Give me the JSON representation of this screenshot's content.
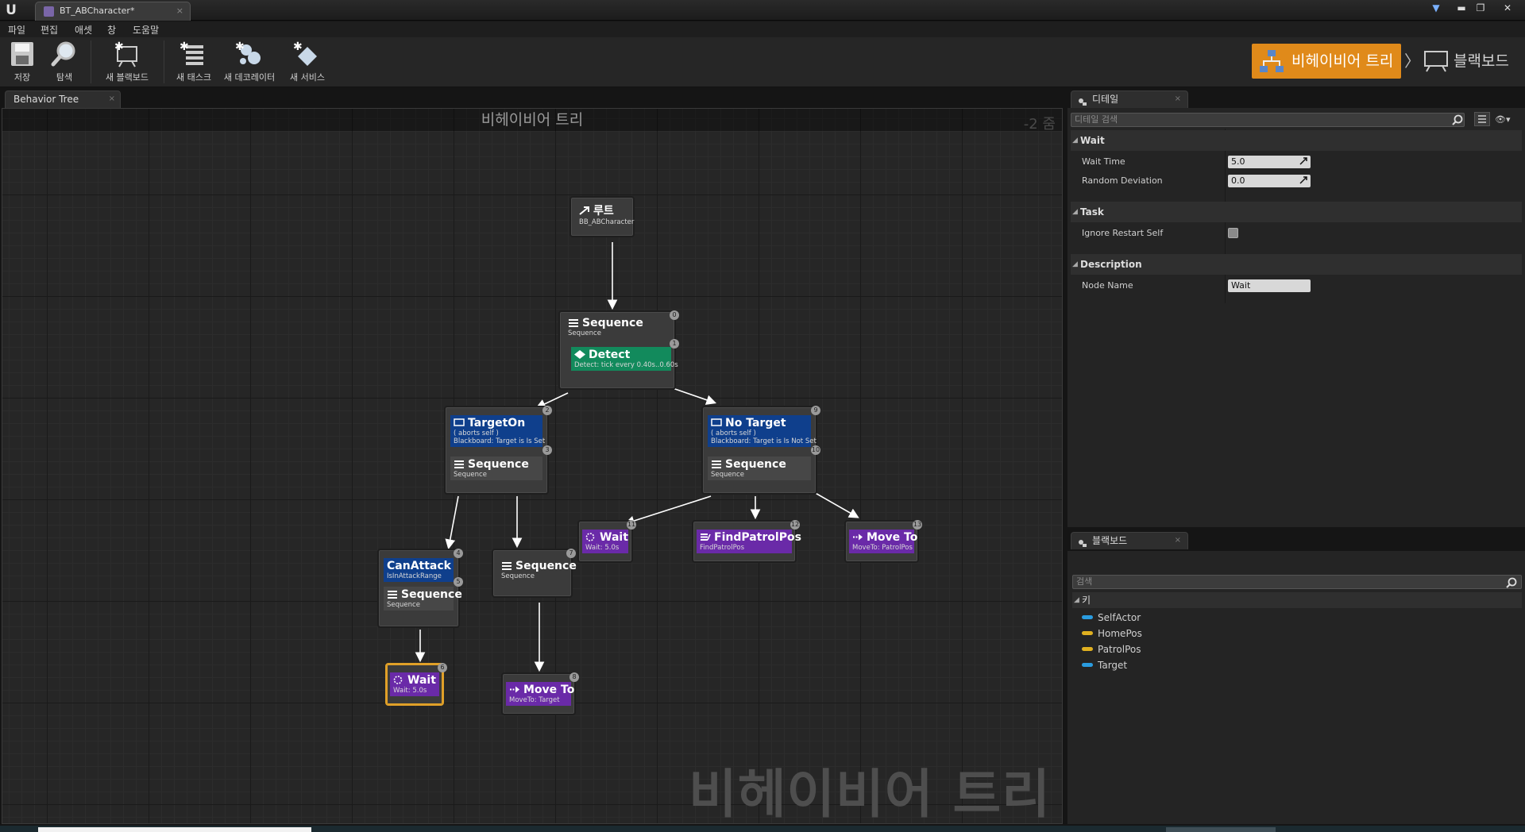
{
  "window": {
    "tab_title": "BT_ABCharacter*",
    "tab_close": "×",
    "controls": {
      "minimize": "▬",
      "restore": "❐",
      "close": "✕"
    }
  },
  "menu": [
    "파일",
    "편집",
    "애셋",
    "창",
    "도움말"
  ],
  "toolbar": {
    "save": "저장",
    "browse": "탐색",
    "new_blackboard": "새 블랙보드",
    "new_task": "새 태스크",
    "new_decorator": "새 데코레이터",
    "new_service": "새 서비스"
  },
  "modes": {
    "behavior_tree": "비헤이비어 트리",
    "chevron": "〉",
    "blackboard": "블랙보드"
  },
  "graph_tab": {
    "label": "Behavior Tree",
    "close": "×"
  },
  "graph": {
    "header": "비헤이비어 트리",
    "zoom": "-2 줌",
    "watermark": "비헤이비어 트리"
  },
  "nodes": {
    "root": {
      "title": "루트",
      "sub": "BB_ABCharacter"
    },
    "seq0": {
      "index": "0",
      "title": "Sequence",
      "sub": "Sequence"
    },
    "detect": {
      "index": "1",
      "title": "Detect",
      "sub": "Detect: tick every 0.40s..0.60s"
    },
    "targeton": {
      "index": "2",
      "title": "TargetOn",
      "sub1": "( aborts self )",
      "sub2": "Blackboard: Target is Is Set",
      "index2": "3",
      "seq_title": "Sequence",
      "seq_sub": "Sequence"
    },
    "notarget": {
      "index": "9",
      "title": "No Target",
      "sub1": "( aborts self )",
      "sub2": "Blackboard: Target is Is Not Set",
      "index2": "10",
      "seq_title": "Sequence",
      "seq_sub": "Sequence"
    },
    "canattack": {
      "index": "4",
      "title": "CanAttack",
      "sub": "IsInAttackRange",
      "index2": "5",
      "seq_title": "Sequence",
      "seq_sub": "Sequence"
    },
    "seq7": {
      "index": "7",
      "title": "Sequence",
      "sub": "Sequence"
    },
    "wait11": {
      "index": "11",
      "title": "Wait",
      "sub": "Wait: 5.0s"
    },
    "findpatrol": {
      "index": "12",
      "title": "FindPatrolPos",
      "sub": "FindPatrolPos"
    },
    "moveto13": {
      "index": "13",
      "title": "Move To",
      "sub": "MoveTo: PatrolPos"
    },
    "wait6": {
      "index": "6",
      "title": "Wait",
      "sub": "Wait: 5.0s"
    },
    "moveto8": {
      "index": "8",
      "title": "Move To",
      "sub": "MoveTo: Target"
    }
  },
  "details": {
    "tab": "디테일",
    "search_placeholder": "디테일 검색",
    "categories": {
      "wait": "Wait",
      "task": "Task",
      "description": "Description"
    },
    "props": {
      "wait_time": {
        "label": "Wait Time",
        "value": "5.0"
      },
      "random_deviation": {
        "label": "Random Deviation",
        "value": "0.0"
      },
      "ignore_restart_self": {
        "label": "Ignore Restart Self",
        "checked": false
      },
      "node_name": {
        "label": "Node Name",
        "value": "Wait"
      }
    }
  },
  "blackboard": {
    "tab": "블랙보드",
    "search_placeholder": "검색",
    "category": "키",
    "keys": [
      {
        "name": "SelfActor",
        "color": "#2a9ce0"
      },
      {
        "name": "HomePos",
        "color": "#e0b020"
      },
      {
        "name": "PatrolPos",
        "color": "#e0b020"
      },
      {
        "name": "Target",
        "color": "#2a9ce0"
      }
    ]
  },
  "colors": {
    "accent_orange": "#e08a1a",
    "composite": "#474747",
    "decorator": "#0f3f8c",
    "service": "#128a5c",
    "task": "#6a2aa8",
    "selection": "#e0a028"
  }
}
